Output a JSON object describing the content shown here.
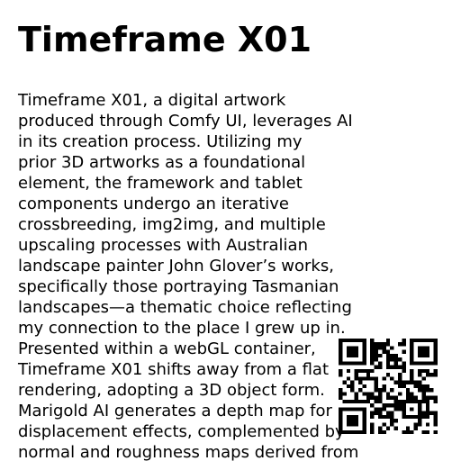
{
  "title": "Timeframe X01",
  "body_lines": [
    "Timeframe X01, a digital artwork",
    "produced through Comfy UI, leverages AI",
    "in its creation process. Utilizing my",
    "prior 3D artworks as a foundational",
    "element, the framework and tablet",
    "components undergo an iterative",
    "crossbreeding, img2img, and multiple",
    "upscaling processes with Australian",
    "landscape painter John Glover’s works,",
    "specifically those portraying Tasmanian",
    "landscapes—a thematic choice reflecting",
    "my connection to the place I grew up in.",
    "Presented within a webGL container,",
    "Timeframe X01 shifts away from a flat",
    "rendering, adopting a 3D object form.",
    "Marigold AI generates a depth map for",
    "displacement effects, complemented by",
    "normal and roughness maps derived from"
  ],
  "icons": {
    "qr": "qr-code-icon"
  },
  "colors": {
    "text": "#000000",
    "background": "#ffffff"
  }
}
